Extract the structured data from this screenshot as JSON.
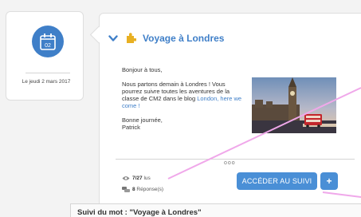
{
  "date_card": {
    "calendar_day": "02",
    "date_text": "Le jeudi 2 mars 2017"
  },
  "post": {
    "title": "Voyage à Londres",
    "greeting": "Bonjour à tous,",
    "message": "Nous partons demain à Londres ! Vous pourrez suivre toutes les aventures de la classe de CM2 dans le blog ",
    "link_text": "London, here we come !",
    "closing_line1": "Bonne journée,",
    "closing_line2": "Patrick",
    "more_dots": "ooo"
  },
  "stats": {
    "reads_value": "7/27",
    "reads_label": " lus",
    "replies_value": "8",
    "replies_label": " Réponse(s)"
  },
  "actions": {
    "access_label": "ACCÉDER AU SUIVI",
    "plus_label": "+"
  },
  "bottom_panel": {
    "title": "Suivi du mot : \"Voyage à Londres\""
  },
  "colors": {
    "accent": "#3f7fc8",
    "button": "#4a8fd6",
    "annotation": "#f0a8ea"
  }
}
